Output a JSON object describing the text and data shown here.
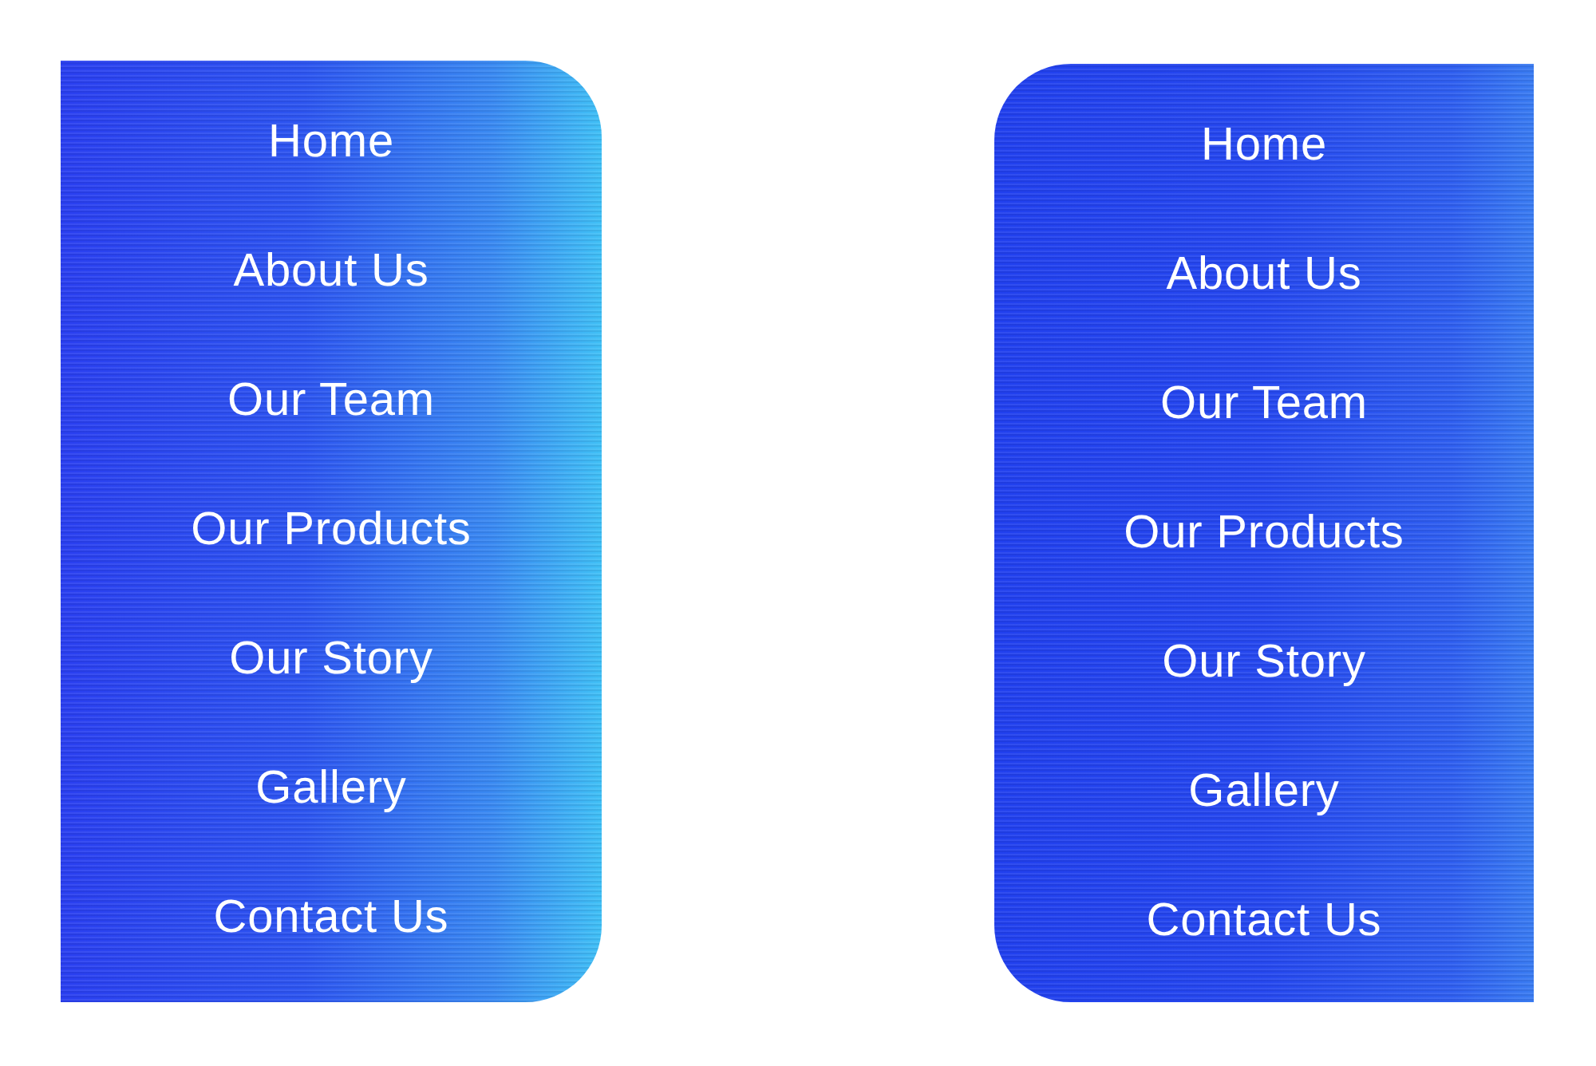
{
  "menus": [
    {
      "kind": "rightround",
      "items": [
        "Home",
        "About Us",
        "Our Team",
        "Our Products",
        "Our Story",
        "Gallery",
        "Contact Us"
      ]
    },
    {
      "kind": "leftround",
      "items": [
        "Home",
        "About Us",
        "Our Team",
        "Our Products",
        "Our Story",
        "Gallery",
        "Contact Us"
      ]
    }
  ]
}
